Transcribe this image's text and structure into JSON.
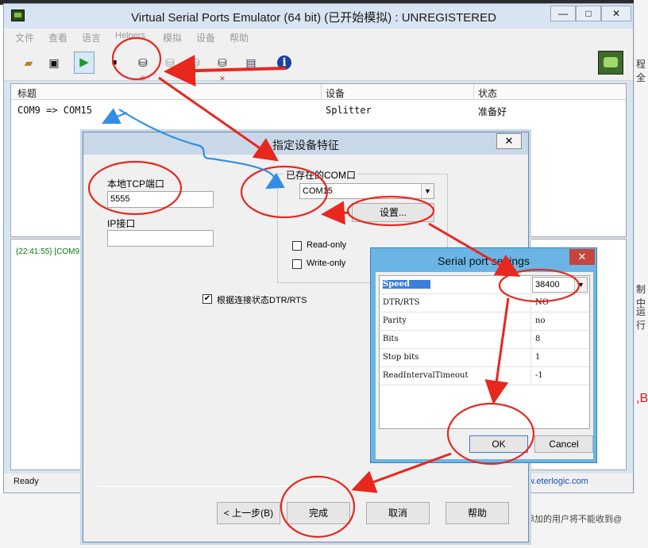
{
  "background": {
    "right_fragments": [
      "程全",
      "制中",
      "运行",
      ",B"
    ],
    "bottom_text": "添加的用户将不能收到@"
  },
  "window": {
    "title": "Virtual Serial Ports Emulator (64 bit) (已开始模拟) : UNREGISTERED",
    "controls": {
      "minimize": "—",
      "maximize": "□",
      "close": "✕"
    }
  },
  "menu": [
    "文件",
    "查看",
    "语言",
    "Helpers",
    "模拟",
    "设备",
    "帮助"
  ],
  "toolbar": {
    "icons": [
      "open-icon",
      "save-icon",
      "play-icon",
      "stop-icon",
      "new-device-icon",
      "device-icon",
      "device-icon",
      "delete-device-icon",
      "properties-icon",
      "info-icon",
      "logo-icon"
    ]
  },
  "device_list": {
    "columns": [
      "标题",
      "设备",
      "状态"
    ],
    "rows": [
      {
        "title": "COM9 => COM15",
        "device": "Splitter",
        "status": "准备好"
      }
    ]
  },
  "log": {
    "line": "{22:41:55} [COM9"
  },
  "status_bar": {
    "text": "Ready",
    "link": "w.eterlogic.com"
  },
  "wizard": {
    "title": "指定设备特征",
    "tcp_port_label": "本地TCP端口",
    "tcp_port_value": "5555",
    "ip_label": "IP接口",
    "ip_value": "",
    "group_label": "已存在的COM口",
    "com_selected": "COM15",
    "settings_button": "设置...",
    "readonly_label": "Read-only",
    "writeonly_label": "Write-only",
    "dtr_label": "根据连接状态DTR/RTS",
    "dtr_checked": "✔",
    "buttons": {
      "back": "< 上一步(B)",
      "finish": "完成",
      "cancel": "取消",
      "help": "帮助"
    }
  },
  "serial_settings": {
    "title": "Serial port settings",
    "rows": [
      {
        "key": "Speed",
        "value": "38400"
      },
      {
        "key": "DTR/RTS",
        "value": "NO"
      },
      {
        "key": "Parity",
        "value": "no"
      },
      {
        "key": "Bits",
        "value": "8"
      },
      {
        "key": "Stop bits",
        "value": "1"
      },
      {
        "key": "ReadIntervalTimeout",
        "value": "-1"
      }
    ],
    "ok": "OK",
    "cancel": "Cancel"
  },
  "annotation_colors": {
    "red": "#e8271e",
    "blue": "#2f8ee6"
  }
}
